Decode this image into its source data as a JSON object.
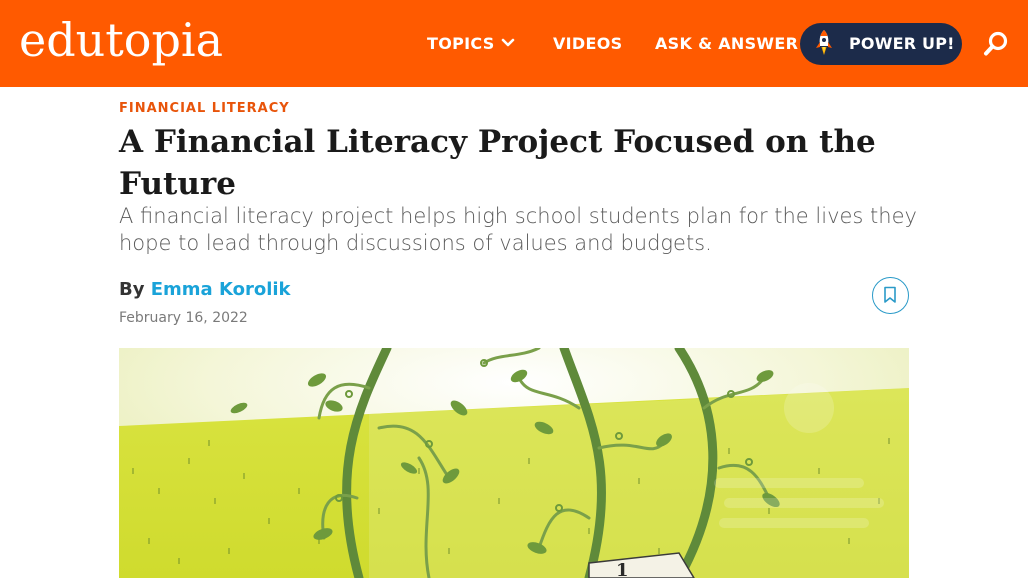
{
  "header": {
    "logo": "edutopia",
    "nav": {
      "topics": "TOPICS",
      "videos": "VIDEOS",
      "ask": "ASK & ANSWER"
    },
    "power_up": "POWER UP!",
    "icons": {
      "chevron": "chevron-down-icon",
      "rocket": "rocket-icon",
      "search": "search-icon"
    }
  },
  "article": {
    "kicker": "FINANCIAL LITERACY",
    "title": "A Financial Literacy Project Focused on the Future",
    "dek": "A financial literacy project helps high school students plan for the lives they hope to lead through discussions of values and budgets.",
    "by_prefix": "By",
    "author": "Emma Korolik",
    "date": "February 16, 2022",
    "bookmark_icon": "bookmark-icon"
  },
  "colors": {
    "brand_orange": "#ff5a00",
    "navy": "#1c2b4a",
    "kicker": "#e8540a",
    "author_link": "#1aa3d9",
    "hero_green": "#d4e13a"
  }
}
